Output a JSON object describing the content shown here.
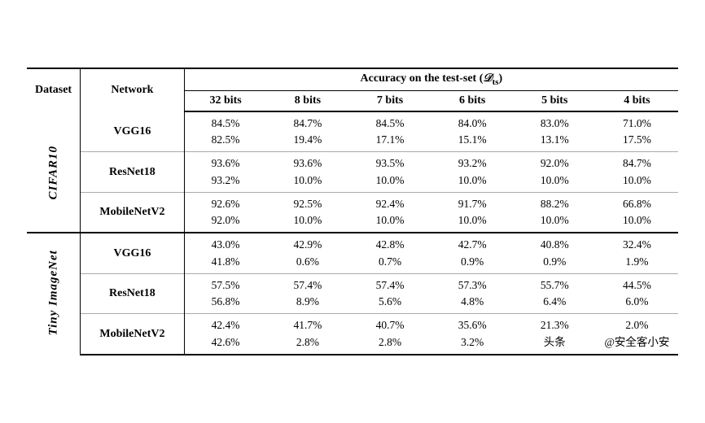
{
  "table": {
    "col_dataset": "Dataset",
    "col_network": "Network",
    "accuracy_header": "Accuracy on the test-set",
    "accuracy_header_suffix": "(D_ts)",
    "bit_columns": [
      "32 bits",
      "8 bits",
      "7 bits",
      "6 bits",
      "5 bits",
      "4 bits"
    ],
    "sections": [
      {
        "dataset": "CIFAR10",
        "rows": [
          {
            "network": "VGG16",
            "values": [
              {
                "line1": "84.5%",
                "line2": "82.5%"
              },
              {
                "line1": "84.7%",
                "line2": "19.4%"
              },
              {
                "line1": "84.5%",
                "line2": "17.1%"
              },
              {
                "line1": "84.0%",
                "line2": "15.1%"
              },
              {
                "line1": "83.0%",
                "line2": "13.1%"
              },
              {
                "line1": "71.0%",
                "line2": "17.5%"
              }
            ]
          },
          {
            "network": "ResNet18",
            "values": [
              {
                "line1": "93.6%",
                "line2": "93.2%"
              },
              {
                "line1": "93.6%",
                "line2": "10.0%"
              },
              {
                "line1": "93.5%",
                "line2": "10.0%"
              },
              {
                "line1": "93.2%",
                "line2": "10.0%"
              },
              {
                "line1": "92.0%",
                "line2": "10.0%"
              },
              {
                "line1": "84.7%",
                "line2": "10.0%"
              }
            ]
          },
          {
            "network": "MobileNetV2",
            "values": [
              {
                "line1": "92.6%",
                "line2": "92.0%"
              },
              {
                "line1": "92.5%",
                "line2": "10.0%"
              },
              {
                "line1": "92.4%",
                "line2": "10.0%"
              },
              {
                "line1": "91.7%",
                "line2": "10.0%"
              },
              {
                "line1": "88.2%",
                "line2": "10.0%"
              },
              {
                "line1": "66.8%",
                "line2": "10.0%"
              }
            ]
          }
        ]
      },
      {
        "dataset": "Tiny ImageNet",
        "rows": [
          {
            "network": "VGG16",
            "values": [
              {
                "line1": "43.0%",
                "line2": "41.8%"
              },
              {
                "line1": "42.9%",
                "line2": "0.6%"
              },
              {
                "line1": "42.8%",
                "line2": "0.7%"
              },
              {
                "line1": "42.7%",
                "line2": "0.9%"
              },
              {
                "line1": "40.8%",
                "line2": "0.9%"
              },
              {
                "line1": "32.4%",
                "line2": "1.9%"
              }
            ]
          },
          {
            "network": "ResNet18",
            "values": [
              {
                "line1": "57.5%",
                "line2": "56.8%"
              },
              {
                "line1": "57.4%",
                "line2": "8.9%"
              },
              {
                "line1": "57.4%",
                "line2": "5.6%"
              },
              {
                "line1": "57.3%",
                "line2": "4.8%"
              },
              {
                "line1": "55.7%",
                "line2": "6.4%"
              },
              {
                "line1": "44.5%",
                "line2": "6.0%"
              }
            ]
          },
          {
            "network": "MobileNetV2",
            "values": [
              {
                "line1": "42.4%",
                "line2": "42.6%"
              },
              {
                "line1": "41.7%",
                "line2": "2.8%"
              },
              {
                "line1": "40.7%",
                "line2": "2.8%"
              },
              {
                "line1": "35.6%",
                "line2": "3.2%"
              },
              {
                "line1": "21.3%",
                "line2": "头条"
              },
              {
                "line1": "2.0%",
                "line2": "@安全客小安"
              }
            ]
          }
        ]
      }
    ]
  }
}
